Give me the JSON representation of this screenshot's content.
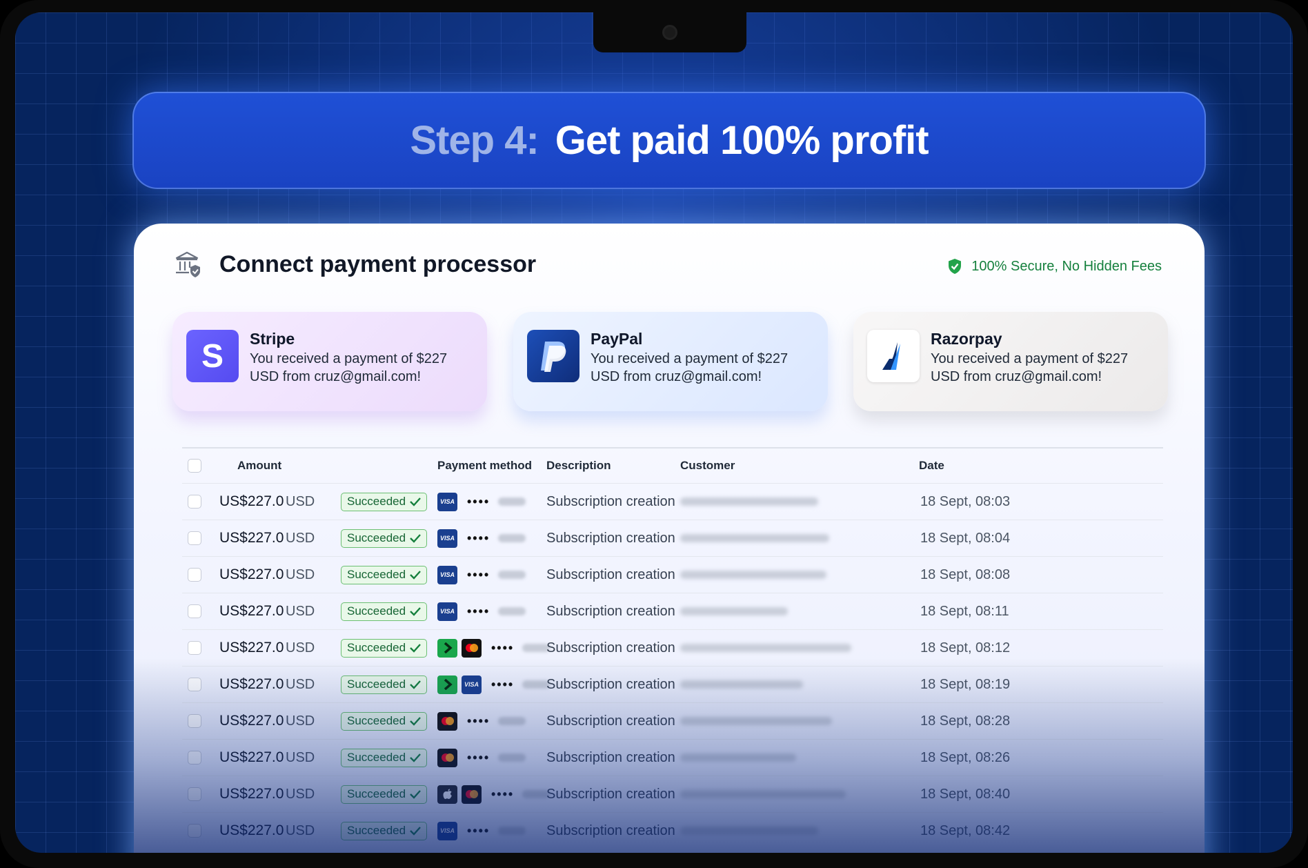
{
  "step": {
    "label": "Step 4:",
    "title": "Get paid 100% profit"
  },
  "card": {
    "title": "Connect payment processor",
    "secure_text": "100% Secure, No Hidden Fees"
  },
  "processors": [
    {
      "name": "Stripe",
      "message": "You received a payment of $227 USD from cruz@gmail.com!"
    },
    {
      "name": "PayPal",
      "message": "You received a payment of $227 USD from cruz@gmail.com!"
    },
    {
      "name": "Razorpay",
      "message": "You received a payment of $227 USD from cruz@gmail.com!"
    }
  ],
  "table": {
    "headers": {
      "amount": "Amount",
      "payment_method": "Payment method",
      "description": "Description",
      "customer": "Customer",
      "date": "Date"
    },
    "rows": [
      {
        "amount": "US$227.0",
        "currency": "USD",
        "status": "Succeeded",
        "methods": [
          "visa"
        ],
        "dots": "••••",
        "description": "Subscription creation",
        "date": "18 Sept, 08:03"
      },
      {
        "amount": "US$227.0",
        "currency": "USD",
        "status": "Succeeded",
        "methods": [
          "visa"
        ],
        "dots": "••••",
        "description": "Subscription creation",
        "date": "18 Sept, 08:04"
      },
      {
        "amount": "US$227.0",
        "currency": "USD",
        "status": "Succeeded",
        "methods": [
          "visa"
        ],
        "dots": "••••",
        "description": "Subscription creation",
        "date": "18 Sept, 08:08"
      },
      {
        "amount": "US$227.0",
        "currency": "USD",
        "status": "Succeeded",
        "methods": [
          "visa"
        ],
        "dots": "••••",
        "description": "Subscription creation",
        "date": "18 Sept, 08:11"
      },
      {
        "amount": "US$227.0",
        "currency": "USD",
        "status": "Succeeded",
        "methods": [
          "link",
          "mastercard"
        ],
        "dots": "••••",
        "description": "Subscription creation",
        "date": "18 Sept, 08:12"
      },
      {
        "amount": "US$227.0",
        "currency": "USD",
        "status": "Succeeded",
        "methods": [
          "link",
          "visa"
        ],
        "dots": "••••",
        "description": "Subscription creation",
        "date": "18 Sept, 08:19"
      },
      {
        "amount": "US$227.0",
        "currency": "USD",
        "status": "Succeeded",
        "methods": [
          "mastercard"
        ],
        "dots": "••••",
        "description": "Subscription creation",
        "date": "18 Sept, 08:28"
      },
      {
        "amount": "US$227.0",
        "currency": "USD",
        "status": "Succeeded",
        "methods": [
          "mastercard"
        ],
        "dots": "••••",
        "description": "Subscription creation",
        "date": "18 Sept, 08:26"
      },
      {
        "amount": "US$227.0",
        "currency": "USD",
        "status": "Succeeded",
        "methods": [
          "apple-pay",
          "mastercard"
        ],
        "dots": "••••",
        "description": "Subscription creation",
        "date": "18 Sept, 08:40"
      },
      {
        "amount": "US$227.0",
        "currency": "USD",
        "status": "Succeeded",
        "methods": [
          "visa"
        ],
        "dots": "••••",
        "description": "Subscription creation",
        "date": "18 Sept, 08:42"
      }
    ]
  },
  "colors": {
    "accent": "#1f50d6",
    "success": "#15803d",
    "background": "#06245e"
  }
}
